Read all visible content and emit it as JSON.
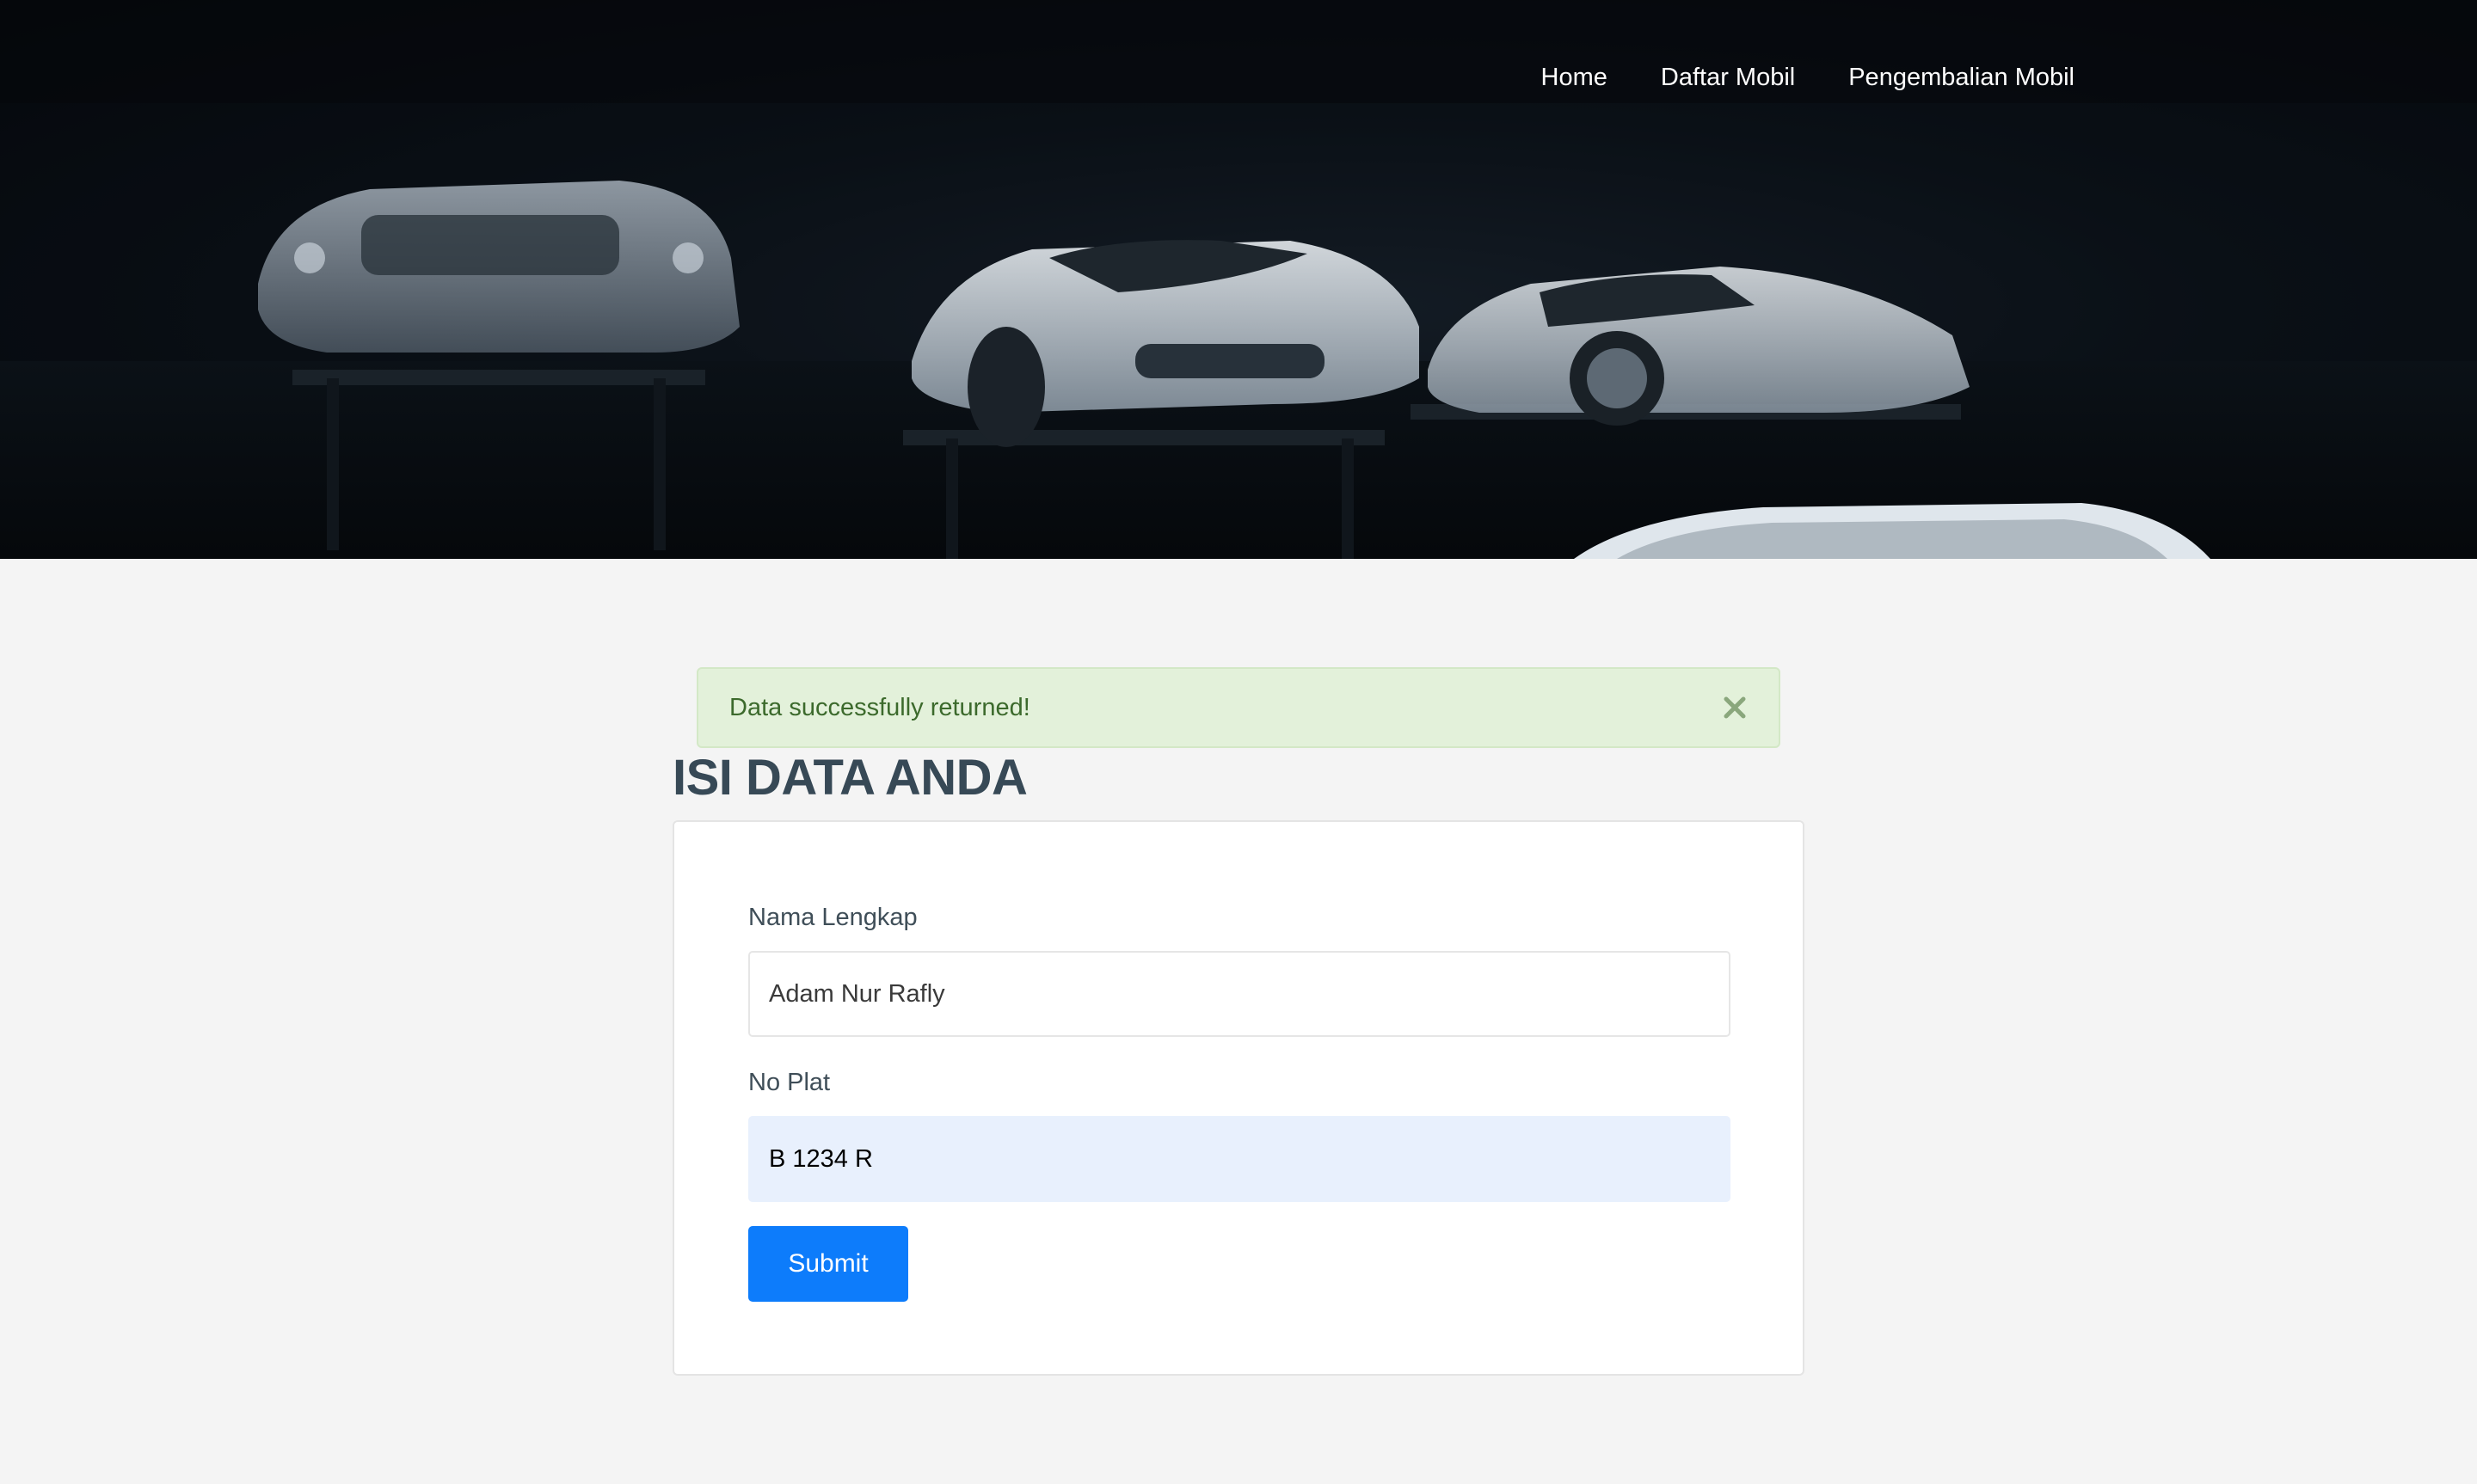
{
  "nav": {
    "items": [
      "Home",
      "Daftar Mobil",
      "Pengembalian Mobil"
    ]
  },
  "alert": {
    "message": "Data successfully returned!",
    "close_icon": "close-icon"
  },
  "form": {
    "heading": "ISI DATA ANDA",
    "name_label": "Nama Lengkap",
    "name_value": "Adam Nur Rafly",
    "plate_label": "No Plat",
    "plate_value": "B 1234 R",
    "submit_label": "Submit"
  },
  "colors": {
    "accent": "#0d7cfb",
    "alert_bg": "#e3f1da",
    "alert_text": "#3c6a2c",
    "heading": "#374956"
  }
}
